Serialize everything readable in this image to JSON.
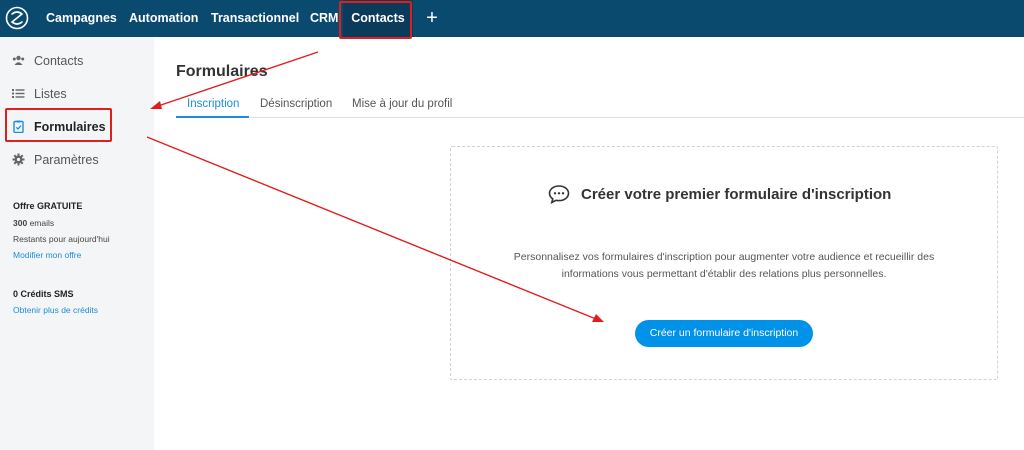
{
  "topnav": {
    "items": [
      {
        "label": "Campagnes"
      },
      {
        "label": "Automation"
      },
      {
        "label": "Transactionnel"
      },
      {
        "label": "CRM"
      },
      {
        "label": "Contacts"
      }
    ],
    "add_label": "+"
  },
  "sidebar": {
    "items": [
      {
        "label": "Contacts",
        "icon": "users-icon"
      },
      {
        "label": "Listes",
        "icon": "list-icon"
      },
      {
        "label": "Formulaires",
        "icon": "clipboard-icon"
      },
      {
        "label": "Paramètres",
        "icon": "gear-icon"
      }
    ],
    "plan": {
      "name": "Offre GRATUITE",
      "emails_count": "300",
      "emails_unit": "emails",
      "remaining": "Restants pour aujourd'hui",
      "modify_link": "Modifier mon offre",
      "sms": "0 Crédits SMS",
      "sms_link": "Obtenir plus de crédits"
    }
  },
  "main": {
    "title": "Formulaires",
    "tabs": [
      {
        "label": "Inscription"
      },
      {
        "label": "Désinscription"
      },
      {
        "label": "Mise à jour du profil"
      }
    ],
    "empty_state": {
      "icon": "chat-icon",
      "title": "Créer votre premier formulaire d'inscription",
      "description_line1": "Personnalisez vos formulaires d'inscription pour augmenter votre audience et recueillir des",
      "description_line2": "informations vous permettant d'établir des relations plus personnelles.",
      "button": "Créer un formulaire d'inscription"
    }
  },
  "colors": {
    "topbar": "#0b4a6f",
    "accent": "#1a8fd8",
    "button": "#0092e8",
    "annotation": "#e01e1e"
  }
}
